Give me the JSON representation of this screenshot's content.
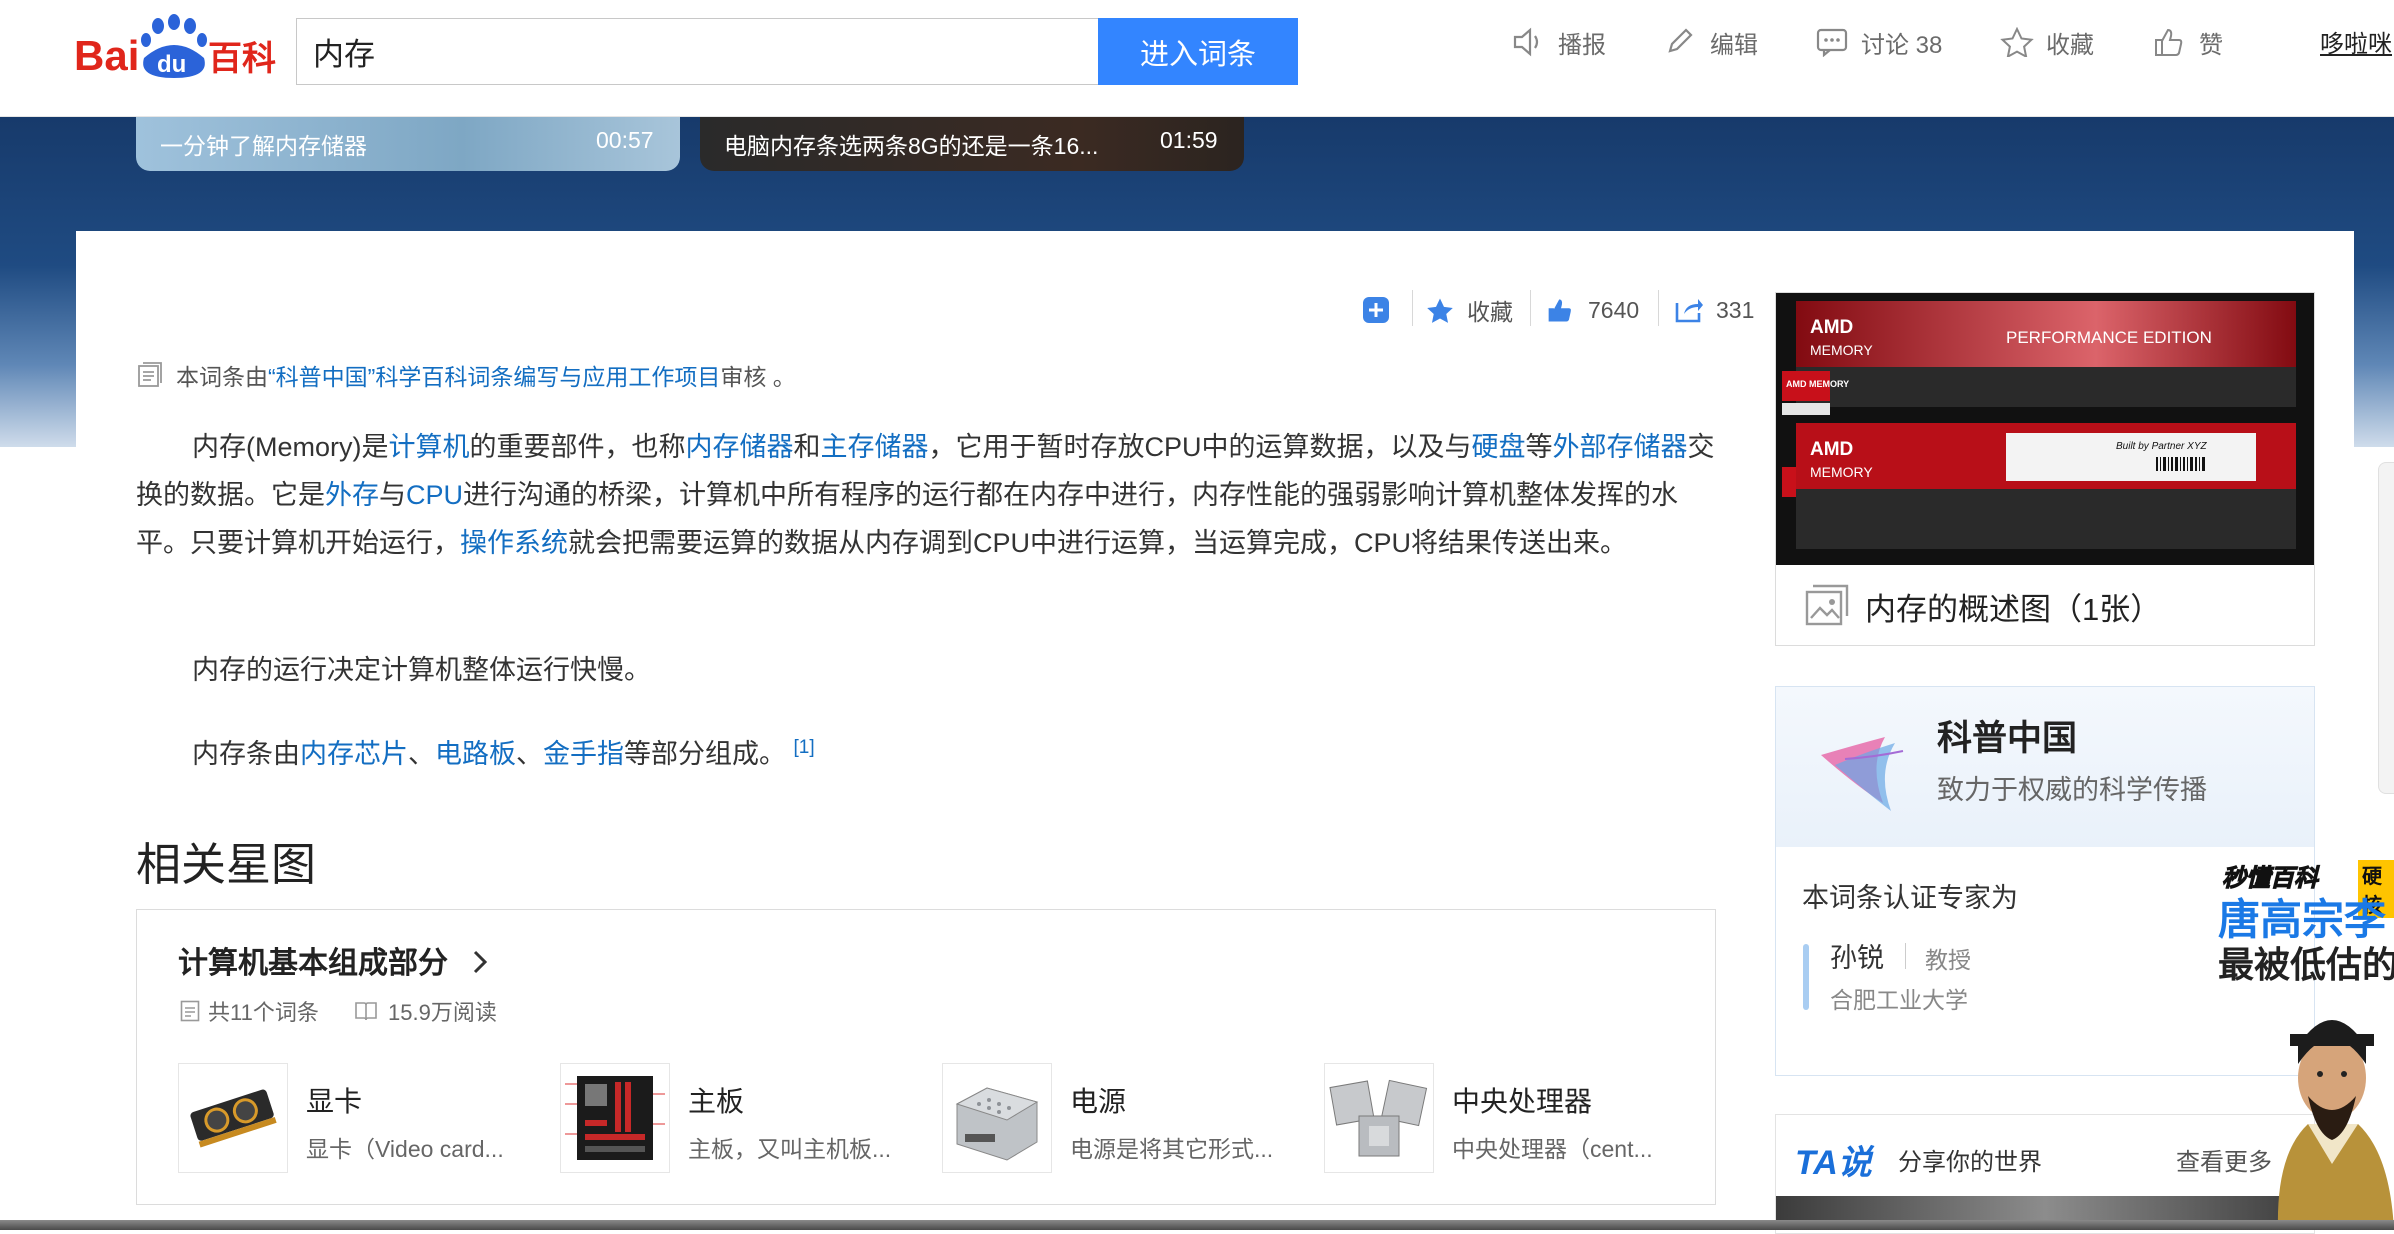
{
  "header": {
    "logo_text": "Bai百科",
    "logo_paw_text": "du",
    "logo_suffix": "百科",
    "search_value": "内存",
    "search_button": "进入词条",
    "actions": [
      {
        "label": "播报",
        "icon": "speaker-icon"
      },
      {
        "label": "编辑",
        "icon": "pencil-icon"
      },
      {
        "label": "讨论 38",
        "icon": "comment-icon"
      },
      {
        "label": "收藏",
        "icon": "star-outline-icon"
      },
      {
        "label": "赞",
        "icon": "thumbs-up-icon"
      }
    ],
    "user": "哆啦咪"
  },
  "videos": [
    {
      "title": "一分钟了解内存储器",
      "duration": "00:57"
    },
    {
      "title": "电脑内存条选两条8G的还是一条16...",
      "duration": "01:59"
    }
  ],
  "toolbar": {
    "collect_label": "收藏",
    "like_count": "7640",
    "share_count": "331"
  },
  "review": {
    "prefix": "本词条由",
    "project": "“科普中国”科学百科词条编写与应用工作项目",
    "suffix": " 审核 。"
  },
  "paragraphs": {
    "p1": [
      {
        "t": "内存(Memory)是"
      },
      {
        "t": "计算机",
        "link": true
      },
      {
        "t": "的重要部件，也称"
      },
      {
        "t": "内存储器",
        "link": true
      },
      {
        "t": "和"
      },
      {
        "t": "主存储器",
        "link": true
      },
      {
        "t": "，它用于暂时存放CPU中的运算数据，以及与"
      },
      {
        "t": "硬盘",
        "link": true
      },
      {
        "t": "等"
      },
      {
        "t": "外部存储器",
        "link": true
      },
      {
        "t": "交换的数据。它是"
      },
      {
        "t": "外存",
        "link": true
      },
      {
        "t": "与"
      },
      {
        "t": "CPU",
        "link": true
      },
      {
        "t": "进行沟通的桥梁，计算机中所有程序的运行都在内存中进行，内存性能的强弱影响计算机整体发挥的水平。只要计算机开始运行，"
      },
      {
        "t": "操作系统",
        "link": true
      },
      {
        "t": "就会把需要运算的数据从内存调到CPU中进行运算，当运算完成，CPU将结果传送出来。"
      }
    ],
    "p2": "内存的运行决定计算机整体运行快慢。",
    "p3": [
      {
        "t": "内存条由"
      },
      {
        "t": "内存芯片",
        "link": true
      },
      {
        "t": "、"
      },
      {
        "t": "电路板",
        "link": true
      },
      {
        "t": "、"
      },
      {
        "t": "金手指",
        "link": true
      },
      {
        "t": "等部分组成。 "
      }
    ],
    "p3_ref": "[1]"
  },
  "related": {
    "heading": "相关星图",
    "title": "计算机基本组成部分",
    "count": "共11个词条",
    "reads": "15.9万阅读",
    "items": [
      {
        "title": "显卡",
        "desc": "显卡（Video card..."
      },
      {
        "title": "主板",
        "desc": "主板，又叫主机板..."
      },
      {
        "title": "电源",
        "desc": "电源是将其它形式..."
      },
      {
        "title": "中央处理器",
        "desc": "中央处理器（cent..."
      }
    ]
  },
  "album": {
    "caption": "内存的概述图（1张）",
    "brand": "AMD",
    "brand_sub": "MEMORY",
    "edition": "PERFORMANCE EDITION",
    "chip_label": "AMD MEMORY",
    "sticker_label": "Built by Partner XYZ"
  },
  "kepu": {
    "name": "科普中国",
    "slogan": "致力于权威的科学传播",
    "expert_label": "本词条认证专家为",
    "expert_name": "孙锐",
    "expert_title": "教授",
    "expert_org": "合肥工业大学"
  },
  "ta": {
    "logo": "TA说",
    "slogan": "分享你的世界",
    "more": "查看更多"
  },
  "float_ad": {
    "brand": "秒懂百科",
    "tag": "硬核",
    "title": "唐高宗李",
    "subtitle": "最被低估的"
  },
  "colors": {
    "accent": "#3385ff",
    "link": "#136ec2",
    "banner": "#1f4b82"
  }
}
